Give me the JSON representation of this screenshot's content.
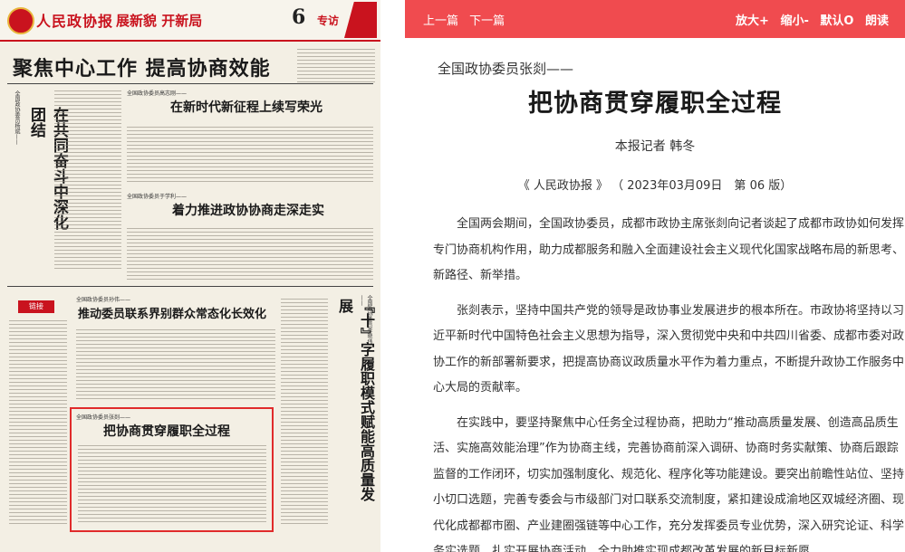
{
  "newspaper": {
    "masthead": "人民政协报",
    "slogan": "展新貌 开新局",
    "page_number": "6",
    "section": "专访",
    "main_headline": "聚焦中心工作 提高协商效能",
    "stories": [
      {
        "kicker": "全国政协委员高志刚——",
        "headline": "在新时代新征程上续写荣光"
      },
      {
        "kicker": "全国政协委员于学利——",
        "headline": "着力推进政协协商走深走实"
      },
      {
        "kicker": "全国政协委员孙伟——",
        "headline": "推动委员联系界别群众常态化长效化"
      },
      {
        "kicker": "全国政协委员张剡——",
        "headline": "把协商贯穿履职全过程"
      }
    ],
    "vertical_left": "在共同奋斗中深化团结",
    "vertical_left_kicker": "全国政协委员杨斌——",
    "vertical_right": "『十』字履职模式赋能高质量发展",
    "vertical_right_kicker": "全国政协委员李晓伟——",
    "badge": "链接"
  },
  "toolbar": {
    "prev": "上一篇",
    "next": "下一篇",
    "zoom_in": "放大+",
    "zoom_out": "缩小-",
    "default": "默认O",
    "read": "朗读"
  },
  "article": {
    "pre_title": "全国政协委员张剡——",
    "title": "把协商贯穿履职全过程",
    "author": "本报记者 韩冬",
    "source": "《 人民政协报 》 （ 2023年03月09日　第 06 版）",
    "paragraphs": [
      "全国两会期间，全国政协委员，成都市政协主席张剡向记者谈起了成都市政协如何发挥专门协商机构作用，助力成都服务和融入全面建设社会主义现代化国家战略布局的新思考、新路径、新举措。",
      "张剡表示，坚持中国共产党的领导是政协事业发展进步的根本所在。市政协将坚持以习近平新时代中国特色社会主义思想为指导，深入贯彻党中央和中共四川省委、成都市委对政协工作的新部署新要求，把提高协商议政质量水平作为着力重点，不断提升政协工作服务中心大局的贡献率。",
      "在实践中，要坚持聚焦中心任务全过程协商，把助力“推动高质量发展、创造高品质生活、实施高效能治理”作为协商主线，完善协商前深入调研、协商时务实献策、协商后跟踪监督的工作闭环，切实加强制度化、规范化、程序化等功能建设。要突出前瞻性站位、坚持小切口选题，完善专委会与市级部门对口联系交流制度，紧扣建设成渝地区双城经济圈、现代化成都都市圈、产业建圈强链等中心工作，充分发挥委员专业优势，深入研究论证、科学务实选题，扎实开展协商活动，全力助推实现成都改革发展的新目标新愿"
    ]
  }
}
